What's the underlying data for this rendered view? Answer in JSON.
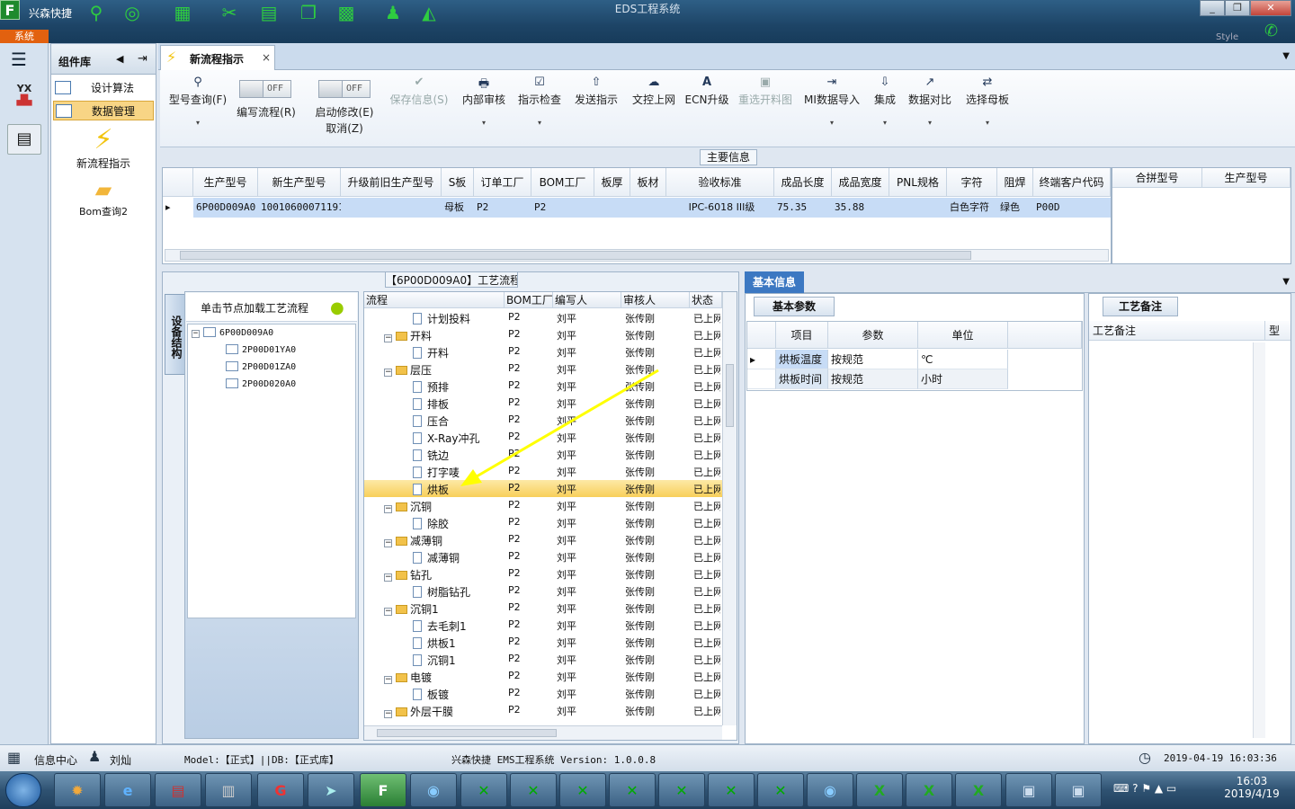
{
  "titlebar": {
    "app_name": "兴森快捷",
    "window_title": "EDS工程系统",
    "system_tab": "系统",
    "style_label": "Style",
    "min_btn": "_",
    "max_btn": "❐",
    "close_btn": "✕"
  },
  "leftbar": {
    "menu_icon": "☰",
    "yx_label": "YX"
  },
  "complib": {
    "title": "组件库",
    "items": [
      {
        "label": "设计算法"
      },
      {
        "label": "数据管理"
      }
    ],
    "big_items": [
      {
        "label": "新流程指示"
      },
      {
        "label": "Bom查询2"
      }
    ]
  },
  "tab": {
    "label": "新流程指示",
    "close": "×"
  },
  "toolbar": {
    "items": [
      {
        "icon": "⚲",
        "label": "型号查询(F)",
        "drop": "▾"
      },
      {
        "icon": "",
        "label": "编写流程(R)",
        "drop": ""
      },
      {
        "icon": "",
        "label": "启动修改(E)",
        "sub": "取消(Z)",
        "drop": ""
      },
      {
        "icon": "✔",
        "label": "保存信息(S)",
        "drop": ""
      },
      {
        "icon": "🖶",
        "label": "内部审核",
        "drop": "▾"
      },
      {
        "icon": "☑",
        "label": "指示检查",
        "drop": "▾"
      },
      {
        "icon": "⇧",
        "label": "发送指示",
        "drop": ""
      },
      {
        "icon": "☁",
        "label": "文控上网",
        "drop": ""
      },
      {
        "icon": "A",
        "label": "ECN升级",
        "drop": ""
      },
      {
        "icon": "▣",
        "label": "重选开料图",
        "drop": ""
      },
      {
        "icon": "⇥",
        "label": "MI数据导入",
        "drop": "▾"
      },
      {
        "icon": "⇩",
        "label": "集成",
        "drop": "▾"
      },
      {
        "icon": "↗",
        "label": "数据对比",
        "drop": "▾"
      },
      {
        "icon": "⇄",
        "label": "选择母板",
        "drop": "▾"
      }
    ],
    "toggle_off": "OFF"
  },
  "main_info": {
    "title": "主要信息",
    "columns": [
      "生产型号",
      "新生产型号",
      "升级前旧生产型号",
      "S板",
      "订单工厂",
      "BOM工厂",
      "板厚",
      "板材",
      "验收标准",
      "成品长度",
      "成品宽度",
      "PNL规格",
      "字符",
      "阻焊",
      "终端客户代码"
    ],
    "row": [
      "6P00D009A0",
      "10010600071191",
      "",
      "母板",
      "P2",
      "P2",
      "",
      "",
      "IPC-6018 III级",
      "75.35",
      "35.88",
      "",
      "白色字符",
      "绿色",
      "P00D"
    ],
    "right_columns": [
      "合拼型号",
      "生产型号"
    ]
  },
  "process": {
    "title": "【6P00D009A0】工艺流程",
    "side_tab": "设备结构",
    "load_hint": "单击节点加载工艺流程",
    "struct_tree": [
      "6P00D009A0",
      "2P00D01YA0",
      "2P00D01ZA0",
      "2P00D020A0"
    ],
    "columns": [
      "流程",
      "BOM工厂",
      "编写人",
      "审核人",
      "状态"
    ],
    "rows": [
      {
        "name": "计划投料",
        "level": 2,
        "type": "file",
        "bom": "P2",
        "writer": "刘平",
        "reviewer": "张传刚",
        "status": "已上网"
      },
      {
        "name": "开料",
        "level": 1,
        "type": "folder",
        "bom": "P2",
        "writer": "刘平",
        "reviewer": "张传刚",
        "status": "已上网"
      },
      {
        "name": "开料",
        "level": 2,
        "type": "file",
        "bom": "P2",
        "writer": "刘平",
        "reviewer": "张传刚",
        "status": "已上网"
      },
      {
        "name": "层压",
        "level": 1,
        "type": "folder",
        "bom": "P2",
        "writer": "刘平",
        "reviewer": "张传刚",
        "status": "已上网"
      },
      {
        "name": "预排",
        "level": 2,
        "type": "file",
        "bom": "P2",
        "writer": "刘平",
        "reviewer": "张传刚",
        "status": "已上网"
      },
      {
        "name": "排板",
        "level": 2,
        "type": "file",
        "bom": "P2",
        "writer": "刘平",
        "reviewer": "张传刚",
        "status": "已上网"
      },
      {
        "name": "压合",
        "level": 2,
        "type": "file",
        "bom": "P2",
        "writer": "刘平",
        "reviewer": "张传刚",
        "status": "已上网"
      },
      {
        "name": "X-Ray冲孔",
        "level": 2,
        "type": "file",
        "bom": "P2",
        "writer": "刘平",
        "reviewer": "张传刚",
        "status": "已上网"
      },
      {
        "name": "铣边",
        "level": 2,
        "type": "file",
        "bom": "P2",
        "writer": "刘平",
        "reviewer": "张传刚",
        "status": "已上网"
      },
      {
        "name": "打字唛",
        "level": 2,
        "type": "file",
        "bom": "P2",
        "writer": "刘平",
        "reviewer": "张传刚",
        "status": "已上网"
      },
      {
        "name": "烘板",
        "level": 2,
        "type": "file",
        "bom": "P2",
        "writer": "刘平",
        "reviewer": "张传刚",
        "status": "已上网",
        "selected": true
      },
      {
        "name": "沉铜",
        "level": 1,
        "type": "folder",
        "bom": "P2",
        "writer": "刘平",
        "reviewer": "张传刚",
        "status": "已上网"
      },
      {
        "name": "除胶",
        "level": 2,
        "type": "file",
        "bom": "P2",
        "writer": "刘平",
        "reviewer": "张传刚",
        "status": "已上网"
      },
      {
        "name": "减薄铜",
        "level": 1,
        "type": "folder",
        "bom": "P2",
        "writer": "刘平",
        "reviewer": "张传刚",
        "status": "已上网"
      },
      {
        "name": "减薄铜",
        "level": 2,
        "type": "file",
        "bom": "P2",
        "writer": "刘平",
        "reviewer": "张传刚",
        "status": "已上网"
      },
      {
        "name": "钻孔",
        "level": 1,
        "type": "folder",
        "bom": "P2",
        "writer": "刘平",
        "reviewer": "张传刚",
        "status": "已上网"
      },
      {
        "name": "树脂钻孔",
        "level": 2,
        "type": "file",
        "bom": "P2",
        "writer": "刘平",
        "reviewer": "张传刚",
        "status": "已上网"
      },
      {
        "name": "沉铜1",
        "level": 1,
        "type": "folder",
        "bom": "P2",
        "writer": "刘平",
        "reviewer": "张传刚",
        "status": "已上网"
      },
      {
        "name": "去毛刺1",
        "level": 2,
        "type": "file",
        "bom": "P2",
        "writer": "刘平",
        "reviewer": "张传刚",
        "status": "已上网"
      },
      {
        "name": "烘板1",
        "level": 2,
        "type": "file",
        "bom": "P2",
        "writer": "刘平",
        "reviewer": "张传刚",
        "status": "已上网"
      },
      {
        "name": "沉铜1",
        "level": 2,
        "type": "file",
        "bom": "P2",
        "writer": "刘平",
        "reviewer": "张传刚",
        "status": "已上网"
      },
      {
        "name": "电镀",
        "level": 1,
        "type": "folder",
        "bom": "P2",
        "writer": "刘平",
        "reviewer": "张传刚",
        "status": "已上网"
      },
      {
        "name": "板镀",
        "level": 2,
        "type": "file",
        "bom": "P2",
        "writer": "刘平",
        "reviewer": "张传刚",
        "status": "已上网"
      },
      {
        "name": "外层干膜",
        "level": 1,
        "type": "folder",
        "bom": "P2",
        "writer": "刘平",
        "reviewer": "张传刚",
        "status": "已上网"
      }
    ]
  },
  "basic": {
    "tab": "基本信息",
    "sub_tab": "基本参数",
    "columns": [
      "项目",
      "参数",
      "单位"
    ],
    "rows": [
      {
        "item": "烘板温度",
        "param": "按规范",
        "unit": "℃"
      },
      {
        "item": "烘板时间",
        "param": "按规范",
        "unit": "小时"
      }
    ]
  },
  "remarks": {
    "tab": "工艺备注",
    "col1": "工艺备注",
    "col2": "型"
  },
  "status": {
    "info_center": "信息中心",
    "user": "刘灿",
    "model": "Model:【正式】||DB:【正式库】",
    "app_version": "兴森快捷 EMS工程系统 Version: 1.0.0.8",
    "datetime": "2019-04-19 16:03:36"
  },
  "taskbar": {
    "time": "16:03",
    "date": "2019/4/19"
  },
  "colors": {
    "accent": "#3c78c2",
    "selection": "#f8cf5a",
    "arrow": "#ffff00"
  }
}
